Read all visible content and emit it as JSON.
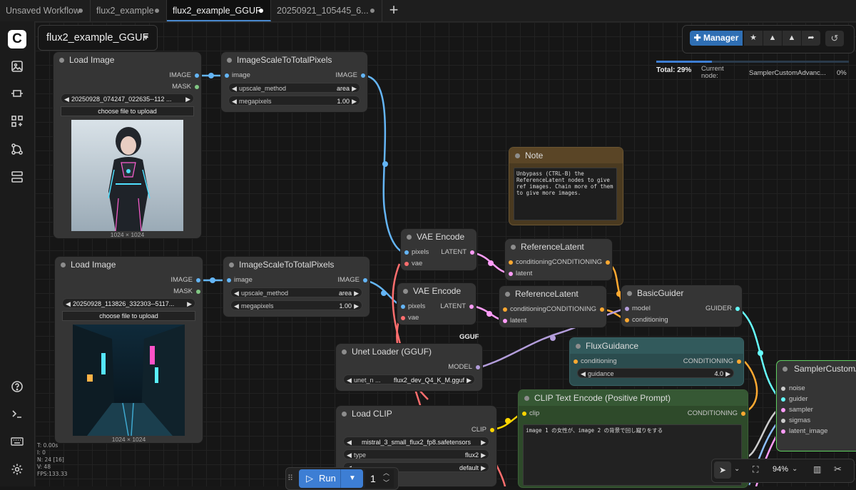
{
  "tabs": [
    {
      "label": "Unsaved Workflow"
    },
    {
      "label": "flux2_example"
    },
    {
      "label": "flux2_example_GGUF"
    },
    {
      "label": "20250921_105445_6..."
    }
  ],
  "add_tab": "+",
  "workflow_name": "flux2_example_GGUF",
  "manager": {
    "label": "Manager",
    "progress_total": "Total: 29%",
    "progress_fraction": 0.29,
    "current_node_label": "Current node:",
    "current_node": "SamplerCustomAdvanc...",
    "node_percent": "0%"
  },
  "nodes": {
    "load1": {
      "title": "Load Image",
      "out_image": "IMAGE",
      "out_mask": "MASK",
      "file": "20250928_074247_022635--112 ...",
      "upload": "choose file to upload",
      "dims": "1024 × 1024"
    },
    "scale1": {
      "title": "ImageScaleToTotalPixels",
      "in_image": "image",
      "out_image": "IMAGE",
      "w1_label": "upscale_method",
      "w1_value": "area",
      "w2_label": "megapixels",
      "w2_value": "1.00"
    },
    "load2": {
      "title": "Load Image",
      "out_image": "IMAGE",
      "out_mask": "MASK",
      "file": "20250928_113826_332303--5117...",
      "upload": "choose file to upload",
      "dims": "1024 × 1024"
    },
    "scale2": {
      "title": "ImageScaleToTotalPixels",
      "in_image": "image",
      "out_image": "IMAGE",
      "w1_label": "upscale_method",
      "w1_value": "area",
      "w2_label": "megapixels",
      "w2_value": "1.00"
    },
    "note": {
      "title": "Note",
      "text": "Unbypass (CTRL-B) the ReferenceLatent nodes to give ref images. Chain more of them to give more images."
    },
    "vae1": {
      "title": "VAE Encode",
      "in1": "pixels",
      "in2": "vae",
      "out": "LATENT"
    },
    "vae2": {
      "title": "VAE Encode",
      "in1": "pixels",
      "in2": "vae",
      "out": "LATENT"
    },
    "ref1": {
      "title": "ReferenceLatent",
      "in1": "conditioning",
      "in2": "latent",
      "out": "CONDITIONING"
    },
    "ref2": {
      "title": "ReferenceLatent",
      "in1": "conditioning",
      "in2": "latent",
      "out": "CONDITIONING"
    },
    "guider": {
      "title": "BasicGuider",
      "in1": "model",
      "in2": "conditioning",
      "out": "GUIDER"
    },
    "unet": {
      "badge": "GGUF",
      "title": "Unet Loader (GGUF)",
      "out": "MODEL",
      "w_label": "unet_n ...",
      "w_value": "flux2_dev_Q4_K_M.gguf"
    },
    "fluxg": {
      "title": "FluxGuidance",
      "in1": "conditioning",
      "out": "CONDITIONING",
      "w_label": "guidance",
      "w_value": "4.0"
    },
    "clipload": {
      "title": "Load CLIP",
      "out": "CLIP",
      "w1_value": "mistral_3_small_flux2_fp8.safetensors",
      "w2_label": "type",
      "w2_value": "flux2",
      "w3_value": "default"
    },
    "cliptext": {
      "title": "CLIP Text Encode (Positive Prompt)",
      "in1": "clip",
      "out": "CONDITIONING",
      "text": "image 1 の女性が、image 2 の背景で回し蹴りをする"
    },
    "sampler": {
      "title": "SamplerCustomAd",
      "in": [
        "noise",
        "guider",
        "sampler",
        "sigmas",
        "latent_image"
      ]
    }
  },
  "run": {
    "label": "Run",
    "count": "1"
  },
  "zoom": "94%",
  "stats": [
    "T: 0.00s",
    "I: 0",
    "N: 24 [16]",
    "V: 48",
    "FPS:133.33"
  ],
  "colors": {
    "accent": "#3d7ed4",
    "image_link": "#64b5f6",
    "latent_link": "#ff9cf9",
    "cond_link": "#ffa931",
    "model_link": "#b39ddb",
    "clip_link": "#ffd500",
    "vae_link": "#ff6e6e",
    "guider_link": "#66ffff"
  }
}
